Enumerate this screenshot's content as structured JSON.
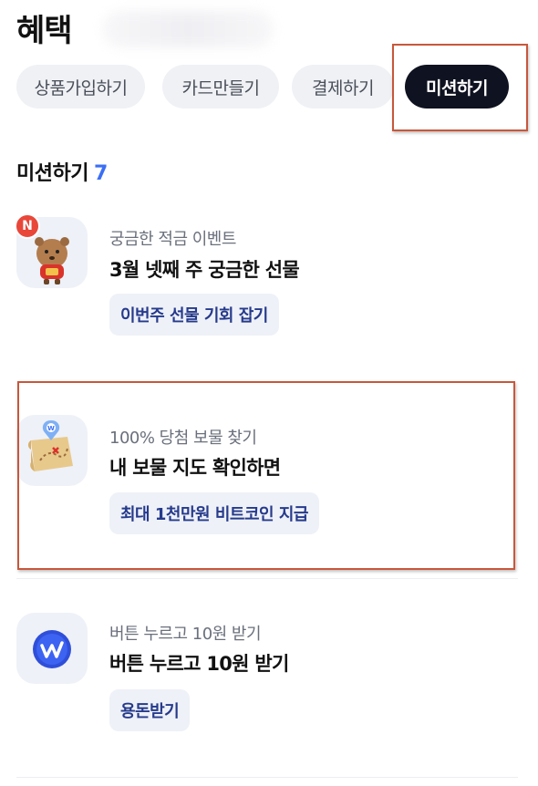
{
  "header": {
    "title": "혜택"
  },
  "tabs": [
    {
      "label": "상품가입하기"
    },
    {
      "label": "카드만들기"
    },
    {
      "label": "결제하기"
    },
    {
      "label": "미션하기",
      "active": true
    }
  ],
  "section": {
    "title": "미션하기",
    "count": "7"
  },
  "missions": [
    {
      "subtitle": "궁금한 적금 이벤트",
      "title": "3월 넷째 주 궁금한 선물",
      "action": "이번주 선물 기회 잡기",
      "badge": "N",
      "icon": "quokka-character-icon"
    },
    {
      "subtitle": "100% 당첨 보물 찾기",
      "title": "내 보물 지도 확인하면",
      "action": "최대 1천만원 비트코인 지급",
      "icon": "treasure-map-icon"
    },
    {
      "subtitle": "버튼 누르고 10원 받기",
      "title": "버튼 누르고 10원 받기",
      "action": "용돈받기",
      "icon": "w-coin-icon"
    }
  ],
  "colors": {
    "accent": "#3b6ff5",
    "highlight": "#c8573b",
    "active_tab": "#0f1220",
    "chip_text": "#263a8c"
  }
}
